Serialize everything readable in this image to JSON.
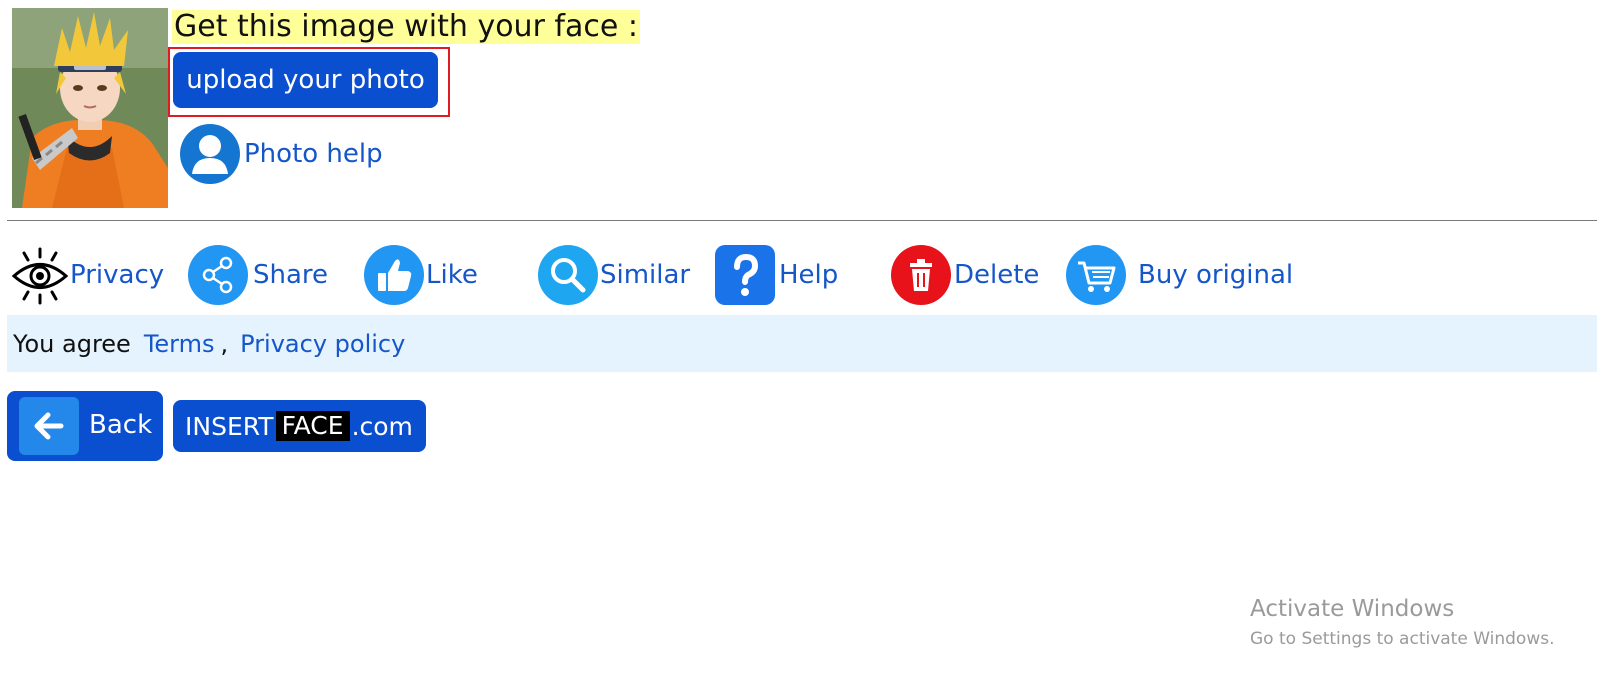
{
  "header": {
    "headline": "Get this image with your face :",
    "thumbnail_icon": "anime-character-image",
    "upload_label": "upload your photo",
    "photo_help_label": "Photo help",
    "photo_help_icon": "user-avatar-icon"
  },
  "actions": [
    {
      "label": "Privacy",
      "icon": "eye-icon"
    },
    {
      "label": "Share",
      "icon": "share-icon"
    },
    {
      "label": "Like",
      "icon": "thumbs-up-icon"
    },
    {
      "label": "Similar",
      "icon": "search-icon"
    },
    {
      "label": "Help",
      "icon": "question-icon"
    },
    {
      "label": "Delete",
      "icon": "trash-icon"
    },
    {
      "label": "Buy original",
      "icon": "cart-icon"
    }
  ],
  "consent": {
    "lead": "You agree",
    "terms": "Terms",
    "separator": ",",
    "privacy_policy": "Privacy policy"
  },
  "nav": {
    "back_label": "Back",
    "back_icon": "arrow-left-icon",
    "brand_pre": "INSERT",
    "brand_highlight": "FACE",
    "brand_post": ".com"
  },
  "watermark": {
    "title": "Activate Windows",
    "subtitle": "Go to Settings to activate Windows."
  },
  "colors": {
    "primary_button": "#0b4fd1",
    "link": "#1556c9",
    "headline_highlight": "#ffff99",
    "consent_bg": "#e4f3fd",
    "delete_red": "#e8121a",
    "icon_blue": "#2196f3"
  }
}
